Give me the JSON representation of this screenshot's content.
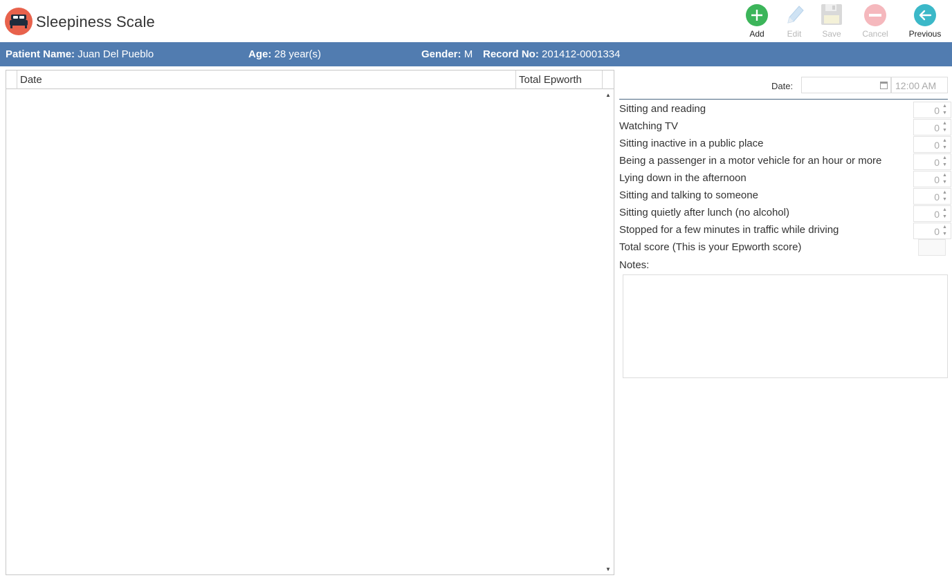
{
  "app": {
    "title": "Sleepiness Scale",
    "logo_icon": "bed-icon"
  },
  "toolbar": {
    "add_label": "Add",
    "edit_label": "Edit",
    "save_label": "Save",
    "cancel_label": "Cancel",
    "previous_label": "Previous"
  },
  "patient": {
    "name_label": "Patient Name:",
    "name": "Juan Del Pueblo",
    "age_label": "Age:",
    "age": "28 year(s)",
    "gender_label": "Gender:",
    "gender": "M",
    "record_label": "Record No:",
    "record": "201412-0001334"
  },
  "grid": {
    "columns": [
      "Date",
      "Total Epworth"
    ],
    "rows": []
  },
  "form": {
    "date_label": "Date:",
    "date_value": "",
    "time_value": "12:00 AM",
    "questions": [
      {
        "label": "Sitting and reading",
        "value": "0"
      },
      {
        "label": "Watching TV",
        "value": "0"
      },
      {
        "label": "Sitting inactive in a public place",
        "value": "0"
      },
      {
        "label": "Being a passenger in a motor vehicle for an hour or more",
        "value": "0"
      },
      {
        "label": "Lying down in the afternoon",
        "value": "0"
      },
      {
        "label": "Sitting and talking to someone",
        "value": "0"
      },
      {
        "label": "Sitting quietly after lunch (no alcohol)",
        "value": "0"
      },
      {
        "label": "Stopped for a few minutes in traffic while driving",
        "value": "0"
      }
    ],
    "total_label": "Total score (This is your Epworth score)",
    "total_value": "",
    "notes_label": "Notes:",
    "notes_value": ""
  },
  "colors": {
    "info_bar": "#517cb0",
    "add": "#3cb55a",
    "previous": "#3bb8c8",
    "logo": "#e8624c"
  }
}
